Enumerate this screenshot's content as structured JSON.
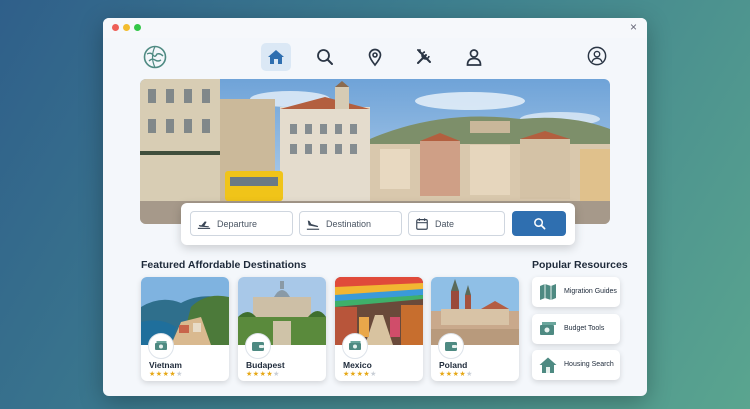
{
  "window": {
    "close_label": "×"
  },
  "nav": {
    "items": [
      {
        "icon": "home-icon",
        "active": true
      },
      {
        "icon": "search-icon",
        "active": false
      },
      {
        "icon": "location-pin-icon",
        "active": false
      },
      {
        "icon": "tools-icon",
        "active": false
      },
      {
        "icon": "user-icon",
        "active": false
      }
    ],
    "profile_icon": "account-circle-icon"
  },
  "search": {
    "departure_placeholder": "Departure",
    "destination_placeholder": "Destination",
    "date_placeholder": "Date"
  },
  "featured": {
    "title": "Featured Affordable Destinations",
    "cards": [
      {
        "name": "Vietnam",
        "rating": 4,
        "max": 5,
        "icon": "money-stack-icon"
      },
      {
        "name": "Budapest",
        "rating": 4,
        "max": 5,
        "icon": "wallet-icon"
      },
      {
        "name": "Mexico",
        "rating": 4,
        "max": 5,
        "icon": "money-stack-icon"
      },
      {
        "name": "Poland",
        "rating": 4,
        "max": 5,
        "icon": "wallet-icon"
      }
    ]
  },
  "resources": {
    "title": "Popular Resources",
    "items": [
      {
        "label": "Migration Guides",
        "icon": "map-icon"
      },
      {
        "label": "Budget Tools",
        "icon": "money-stack-icon"
      },
      {
        "label": "Housing Search",
        "icon": "house-icon"
      }
    ]
  },
  "colors": {
    "accent": "#2f6fb0",
    "icon_teal": "#4e8a82",
    "star": "#e6a817"
  }
}
